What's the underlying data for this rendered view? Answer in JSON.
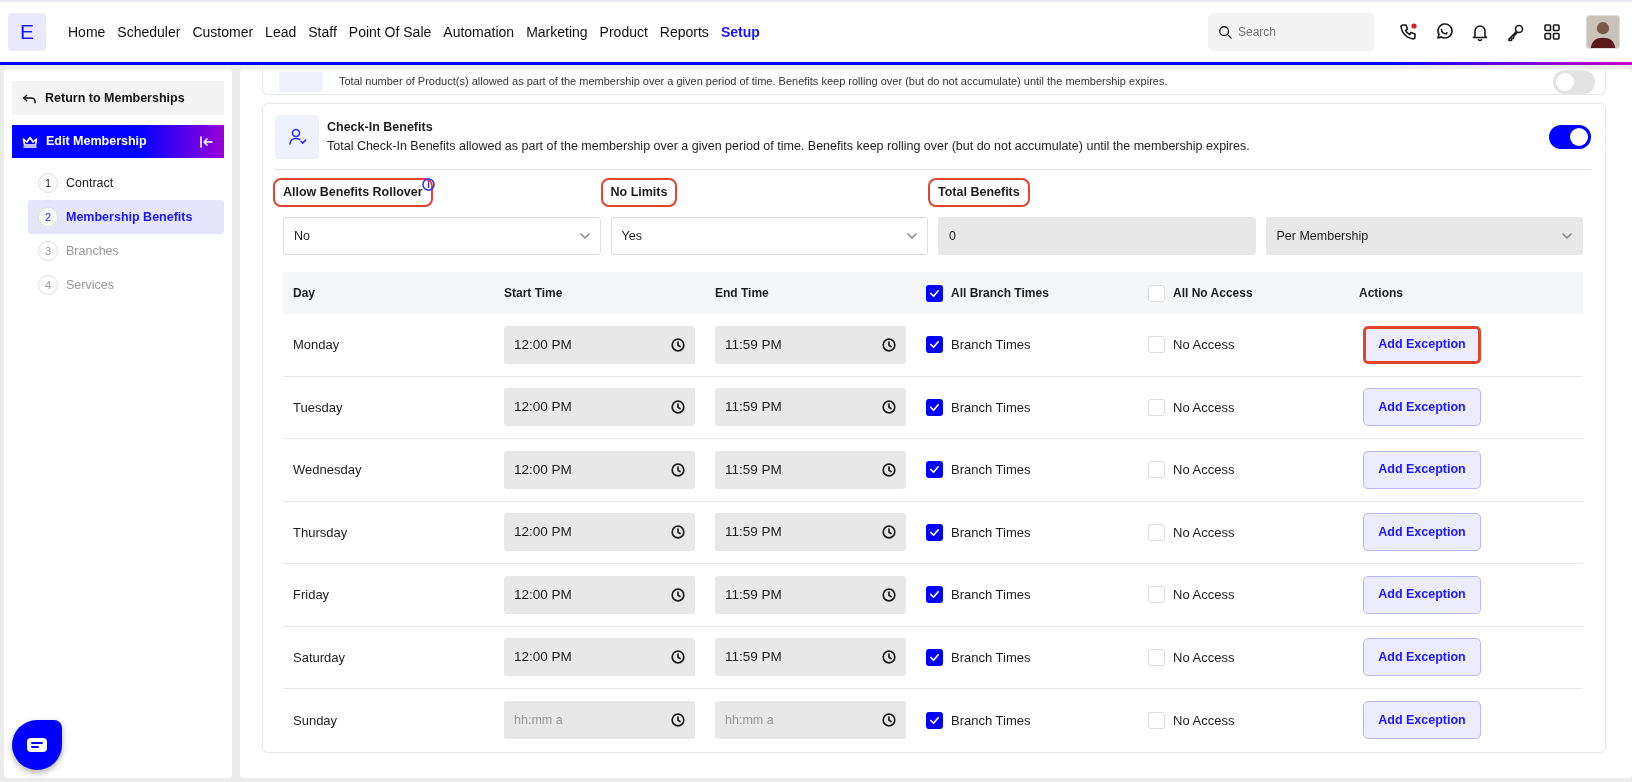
{
  "nav": {
    "logo": "E",
    "items": [
      {
        "label": "Home",
        "selected": false
      },
      {
        "label": "Scheduler",
        "selected": false
      },
      {
        "label": "Customer",
        "selected": false
      },
      {
        "label": "Lead",
        "selected": false
      },
      {
        "label": "Staff",
        "selected": false
      },
      {
        "label": "Point Of Sale",
        "selected": false
      },
      {
        "label": "Automation",
        "selected": false
      },
      {
        "label": "Marketing",
        "selected": false
      },
      {
        "label": "Product",
        "selected": false
      },
      {
        "label": "Reports",
        "selected": false
      },
      {
        "label": "Setup",
        "selected": true
      }
    ],
    "search": {
      "placeholder": "Search"
    },
    "call_alert": true
  },
  "sidebar": {
    "back": "Return to Memberships",
    "header": "Edit Membership",
    "steps": [
      {
        "number": "1",
        "label": "Contract",
        "selected": false,
        "disabled": false
      },
      {
        "number": "2",
        "label": "Membership Benefits",
        "selected": true,
        "disabled": false
      },
      {
        "number": "3",
        "label": "Branches",
        "selected": false,
        "disabled": true
      },
      {
        "number": "4",
        "label": "Services",
        "selected": false,
        "disabled": true
      }
    ]
  },
  "prev_card": {
    "description": "Total number of Product(s) allowed as part of the membership over a given period of time. Benefits keep rolling over (but do not accumulate) until the membership expires.",
    "on": false
  },
  "card": {
    "title": "Check-In Benefits",
    "description": "Total Check-In Benefits allowed as part of the membership over a given period of time. Benefits keep rolling over (but do not accumulate) until the membership expires.",
    "on": true,
    "fields": [
      {
        "kind": "select",
        "label": "Allow Benefits Rollover",
        "highlighted": true,
        "info": true,
        "value": "No",
        "disabled": false
      },
      {
        "kind": "select",
        "label": "No Limits",
        "highlighted": true,
        "info": false,
        "value": "Yes",
        "disabled": false
      },
      {
        "kind": "input",
        "label": "Total Benefits",
        "highlighted": true,
        "info": false,
        "value": "0",
        "disabled": true
      },
      {
        "kind": "select",
        "value": "Per Membership",
        "disabled": true
      }
    ],
    "table": {
      "columns": [
        {
          "kind": "text",
          "label": "Day"
        },
        {
          "kind": "text",
          "label": "Start Time"
        },
        {
          "kind": "text",
          "label": "End Time"
        },
        {
          "kind": "checkbox",
          "label": "All Branch Times",
          "checked": true
        },
        {
          "kind": "checkbox",
          "label": "All No Access",
          "checked": false
        },
        {
          "kind": "text",
          "label": "Actions"
        }
      ],
      "rows": [
        {
          "day": "Monday",
          "start": {
            "value": "12:00 PM"
          },
          "end": {
            "value": "11:59 PM"
          },
          "branch_times": {
            "label": "Branch Times",
            "checked": true
          },
          "no_access": {
            "label": "No Access",
            "checked": false
          },
          "action": {
            "label": "Add Exception",
            "highlighted": true
          }
        },
        {
          "day": "Tuesday",
          "start": {
            "value": "12:00 PM"
          },
          "end": {
            "value": "11:59 PM"
          },
          "branch_times": {
            "label": "Branch Times",
            "checked": true
          },
          "no_access": {
            "label": "No Access",
            "checked": false
          },
          "action": {
            "label": "Add Exception",
            "highlighted": false
          }
        },
        {
          "day": "Wednesday",
          "start": {
            "value": "12:00 PM"
          },
          "end": {
            "value": "11:59 PM"
          },
          "branch_times": {
            "label": "Branch Times",
            "checked": true
          },
          "no_access": {
            "label": "No Access",
            "checked": false
          },
          "action": {
            "label": "Add Exception",
            "highlighted": false
          }
        },
        {
          "day": "Thursday",
          "start": {
            "value": "12:00 PM"
          },
          "end": {
            "value": "11:59 PM"
          },
          "branch_times": {
            "label": "Branch Times",
            "checked": true
          },
          "no_access": {
            "label": "No Access",
            "checked": false
          },
          "action": {
            "label": "Add Exception",
            "highlighted": false
          }
        },
        {
          "day": "Friday",
          "start": {
            "value": "12:00 PM"
          },
          "end": {
            "value": "11:59 PM"
          },
          "branch_times": {
            "label": "Branch Times",
            "checked": true
          },
          "no_access": {
            "label": "No Access",
            "checked": false
          },
          "action": {
            "label": "Add Exception",
            "highlighted": false
          }
        },
        {
          "day": "Saturday",
          "start": {
            "value": "12:00 PM"
          },
          "end": {
            "value": "11:59 PM"
          },
          "branch_times": {
            "label": "Branch Times",
            "checked": true
          },
          "no_access": {
            "label": "No Access",
            "checked": false
          },
          "action": {
            "label": "Add Exception",
            "highlighted": false
          }
        },
        {
          "day": "Sunday",
          "start": {
            "placeholder": "hh:mm a"
          },
          "end": {
            "placeholder": "hh:mm a"
          },
          "branch_times": {
            "label": "Branch Times",
            "checked": true
          },
          "no_access": {
            "label": "No Access",
            "checked": false
          },
          "action": {
            "label": "Add Exception",
            "highlighted": false
          }
        }
      ]
    }
  }
}
